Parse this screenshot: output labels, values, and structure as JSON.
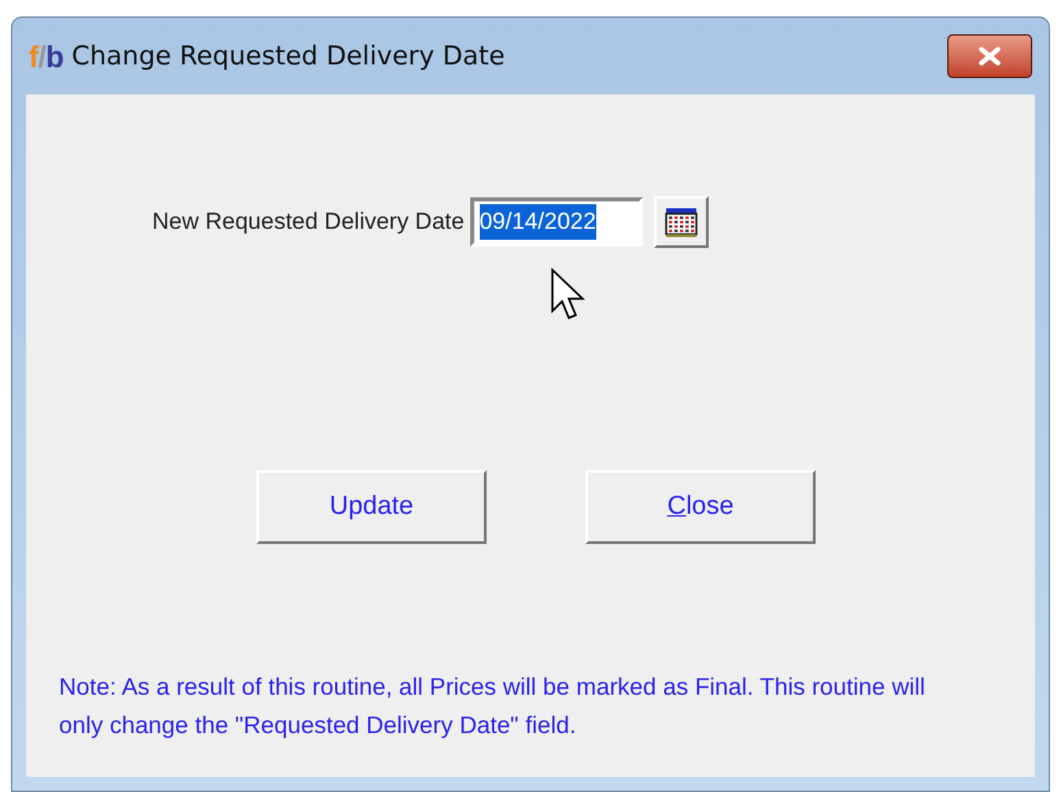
{
  "window": {
    "logo": "f/b",
    "title": "Change Requested Delivery Date"
  },
  "date_field": {
    "label": "New Requested Delivery Date",
    "value": "09/14/2022",
    "selected": true
  },
  "buttons": [
    {
      "label": "Update",
      "underline_first": false
    },
    {
      "label": "Close",
      "underline_first": true
    }
  ],
  "note": "Note: As a result of this routine, all Prices will be marked as Final. This routine will only change the \"Requested Delivery Date\" field."
}
